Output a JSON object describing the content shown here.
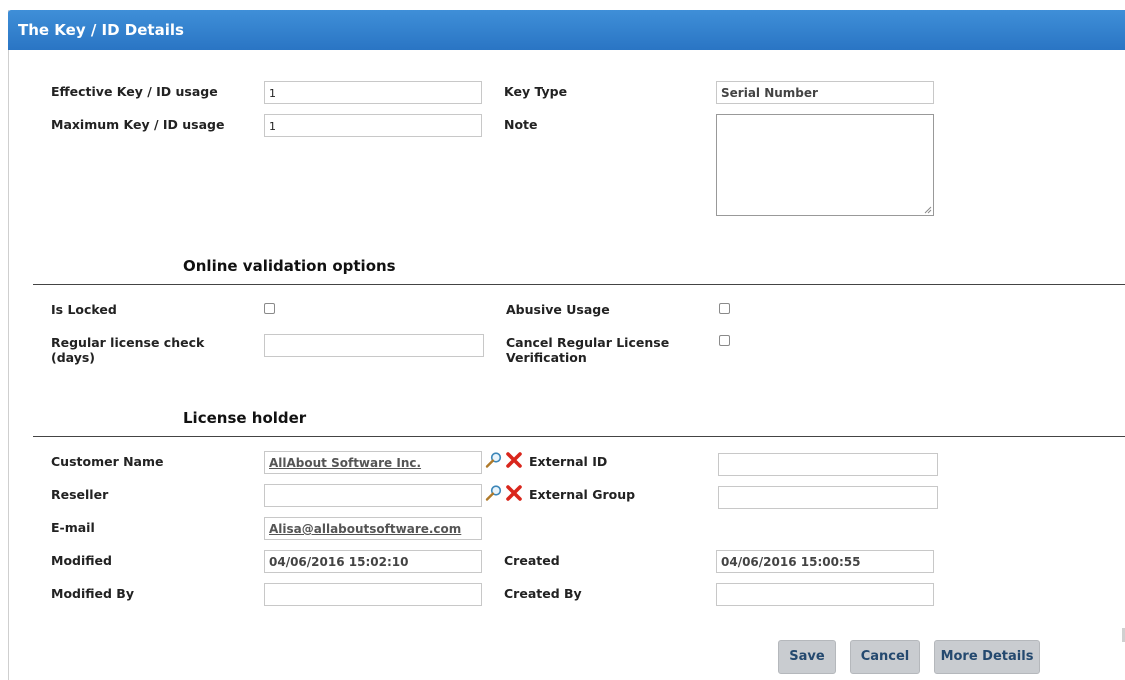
{
  "header": {
    "title": "The Key / ID Details"
  },
  "key_details": {
    "effective_usage": {
      "label": "Effective Key / ID usage",
      "value": "1"
    },
    "maximum_usage": {
      "label": "Maximum Key / ID usage",
      "value": "1"
    },
    "key_type": {
      "label": "Key Type",
      "value": "Serial Number"
    },
    "note": {
      "label": "Note",
      "value": ""
    }
  },
  "online_validation": {
    "title": "Online validation options",
    "is_locked": {
      "label": "Is Locked",
      "checked": false
    },
    "abusive_usage": {
      "label": "Abusive Usage",
      "checked": false
    },
    "regular_check": {
      "label_line1": "Regular license check",
      "label_line2": "(days)",
      "value": ""
    },
    "cancel_regular": {
      "label_line1": "Cancel Regular License",
      "label_line2": "Verification",
      "checked": false
    }
  },
  "license_holder": {
    "title": "License holder",
    "customer_name": {
      "label": "Customer Name",
      "value": "AllAbout Software Inc."
    },
    "external_id": {
      "label": "External ID",
      "value": ""
    },
    "reseller": {
      "label": "Reseller",
      "value": ""
    },
    "external_group": {
      "label": "External Group",
      "value": ""
    },
    "email": {
      "label": "E-mail",
      "value": "Alisa@allaboutsoftware.com"
    },
    "modified": {
      "label": "Modified",
      "value": "04/06/2016 15:02:10"
    },
    "created": {
      "label": "Created",
      "value": "04/06/2016 15:00:55"
    },
    "modified_by": {
      "label": "Modified By",
      "value": ""
    },
    "created_by": {
      "label": "Created By",
      "value": ""
    }
  },
  "icons": {
    "lookup": "magnifier-icon",
    "clear": "red-x-icon"
  },
  "buttons": {
    "save": "Save",
    "cancel": "Cancel",
    "more_details": "More Details"
  },
  "colors": {
    "header": "#2a75c4",
    "button_text": "#24496f",
    "clear_icon": "#d9261c"
  }
}
